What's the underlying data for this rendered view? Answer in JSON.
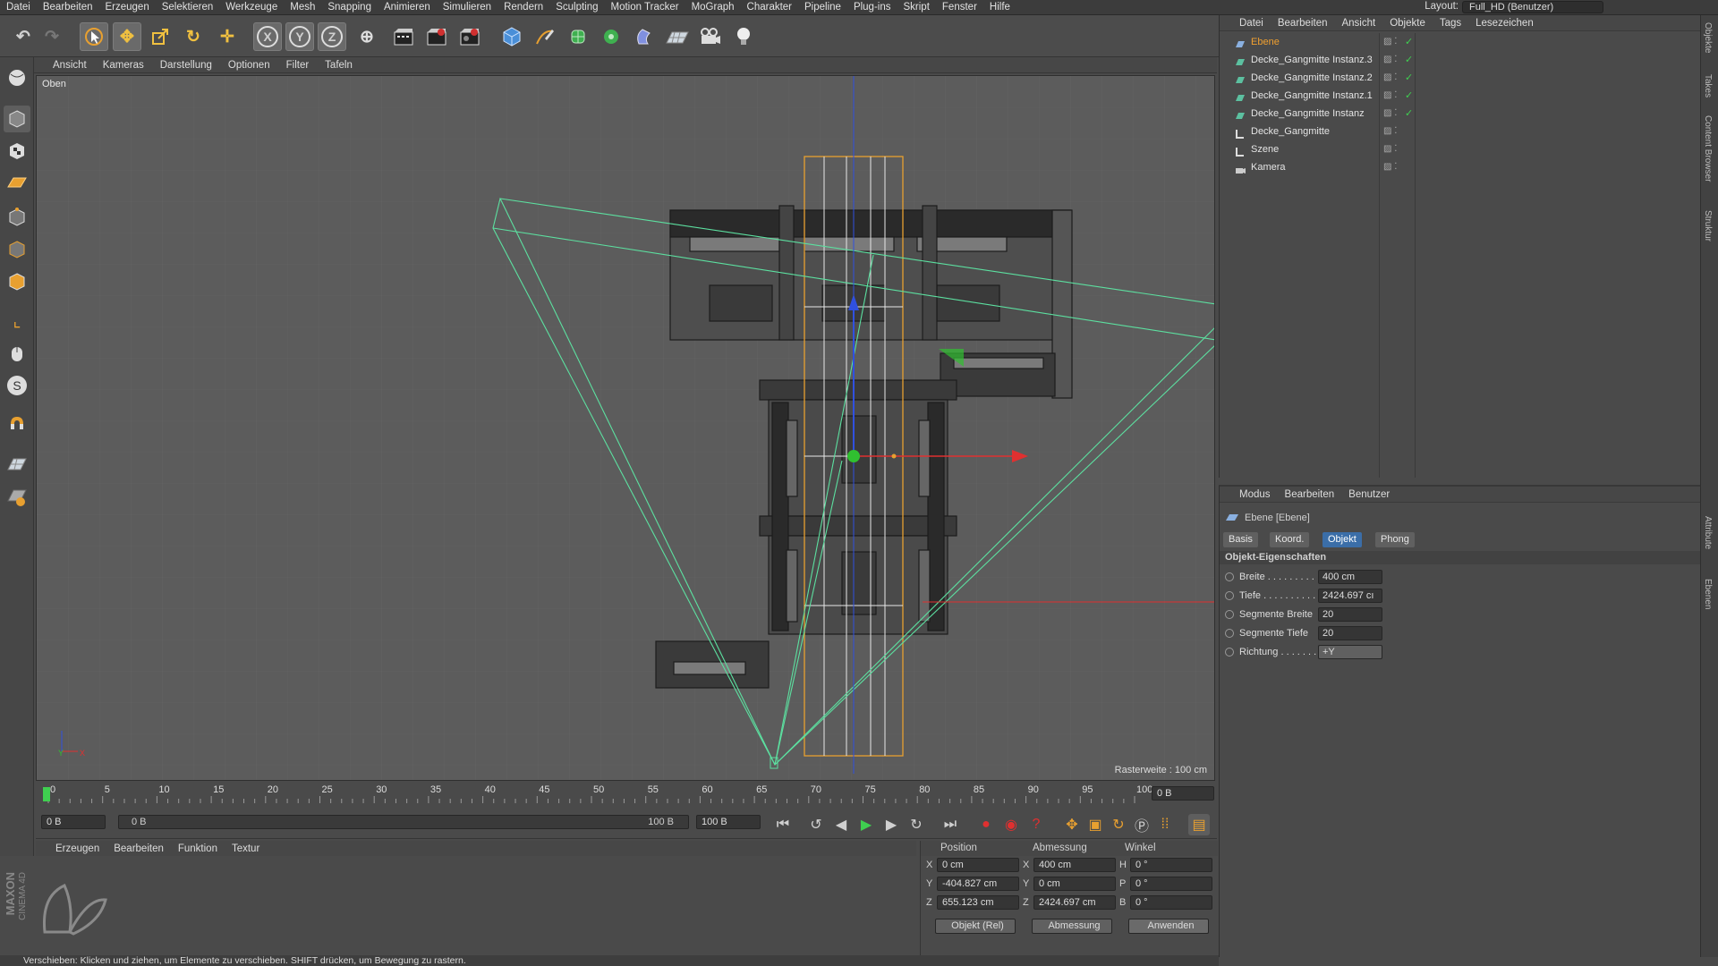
{
  "menubar": {
    "items": [
      "Datei",
      "Bearbeiten",
      "Erzeugen",
      "Selektieren",
      "Werkzeuge",
      "Mesh",
      "Snapping",
      "Animieren",
      "Simulieren",
      "Rendern",
      "Sculpting",
      "Motion Tracker",
      "MoGraph",
      "Charakter",
      "Pipeline",
      "Plug-ins",
      "Skript",
      "Fenster",
      "Hilfe"
    ],
    "layout_label": "Layout:",
    "layout_value": "Full_HD (Benutzer)"
  },
  "toolbar": {
    "icons": [
      "undo-icon",
      "redo-icon",
      "live-select-icon",
      "move-icon",
      "scale-icon",
      "rotate-icon",
      "create-icon",
      "x-axis-icon",
      "y-axis-icon",
      "z-axis-icon",
      "world-coordinates-icon",
      "render-view-icon",
      "render-picture-viewer-icon",
      "edit-render-settings-icon",
      "cube-icon",
      "pen-icon",
      "subdivision-icon",
      "cloner-icon",
      "deformer-icon",
      "floor-icon",
      "camera-icon",
      "light-icon"
    ],
    "axis": {
      "x": "X",
      "y": "Y",
      "z": "Z"
    }
  },
  "viewport": {
    "menu": [
      "Ansicht",
      "Kameras",
      "Darstellung",
      "Optionen",
      "Filter",
      "Tafeln"
    ],
    "view_name": "Oben",
    "grid_label": "Rasterweite : 100 cm",
    "gizmo": {
      "y": "Y",
      "x": "X"
    }
  },
  "timeline": {
    "ticks": [
      "0",
      "5",
      "10",
      "15",
      "20",
      "25",
      "30",
      "35",
      "40",
      "45",
      "50",
      "55",
      "60",
      "65",
      "70",
      "75",
      "80",
      "85",
      "90",
      "95",
      "100"
    ],
    "end_field": "0 B",
    "current_frame": "0 B",
    "range_start": "0 B",
    "range_end": "100 B",
    "max_frame": "100 B"
  },
  "material": {
    "menu": [
      "Erzeugen",
      "Bearbeiten",
      "Funktion",
      "Textur"
    ],
    "brand_top": "MAXON",
    "brand_bottom": "CINEMA 4D"
  },
  "coordinates": {
    "headers": [
      "Position",
      "Abmessung",
      "Winkel"
    ],
    "rows": [
      {
        "pl": "X",
        "pos": "0 cm",
        "sl": "X",
        "size": "400 cm",
        "al": "H",
        "rot": "0 °"
      },
      {
        "pl": "Y",
        "pos": "-404.827 cm",
        "sl": "Y",
        "size": "0 cm",
        "al": "P",
        "rot": "0 °"
      },
      {
        "pl": "Z",
        "pos": "655.123 cm",
        "sl": "Z",
        "size": "2424.697 cm",
        "al": "B",
        "rot": "0 °"
      }
    ],
    "mode1": "Objekt (Rel)",
    "mode2": "Abmessung",
    "apply": "Anwenden"
  },
  "status": "Verschieben: Klicken und ziehen, um Elemente zu verschieben. SHIFT drücken, um Bewegung zu rastern.",
  "objects": {
    "menu": [
      "Datei",
      "Bearbeiten",
      "Ansicht",
      "Objekte",
      "Tags",
      "Lesezeichen"
    ],
    "items": [
      {
        "name": "Ebene",
        "selected": true
      },
      {
        "name": "Decke_Gangmitte Instanz.3",
        "selected": false
      },
      {
        "name": "Decke_Gangmitte Instanz.2",
        "selected": false
      },
      {
        "name": "Decke_Gangmitte Instanz.1",
        "selected": false
      },
      {
        "name": "Decke_Gangmitte Instanz",
        "selected": false
      },
      {
        "name": "Decke_Gangmitte",
        "selected": false
      },
      {
        "name": "Szene",
        "selected": false
      },
      {
        "name": "Kamera",
        "selected": false
      }
    ]
  },
  "attributes": {
    "menu": [
      "Modus",
      "Bearbeiten",
      "Benutzer"
    ],
    "title": "Ebene [Ebene]",
    "tabs": [
      "Basis",
      "Koord.",
      "Objekt",
      "Phong"
    ],
    "active_tab": "Objekt",
    "section": "Objekt-Eigenschaften",
    "props": [
      {
        "label": "Breite . . . . . . . . .",
        "value": "400 cm"
      },
      {
        "label": "Tiefe . . . . . . . . . .",
        "value": "2424.697 cı"
      },
      {
        "label": "Segmente Breite",
        "value": "20"
      },
      {
        "label": "Segmente Tiefe",
        "value": "20"
      },
      {
        "label": "Richtung . . . . . . .",
        "value": "+Y"
      }
    ]
  },
  "right_tabs": [
    "Objekte",
    "Takes",
    "Content Browser",
    "Struktur",
    "Attribute",
    "Ebenen"
  ],
  "colors": {
    "accent": "#3b6ea8",
    "selected_text": "#f0a030",
    "axis_x": "#e03030",
    "axis_y": "#30c030",
    "axis_z": "#3050e0",
    "frustum": "#5ce0a0",
    "bbox": "#e8a030"
  }
}
